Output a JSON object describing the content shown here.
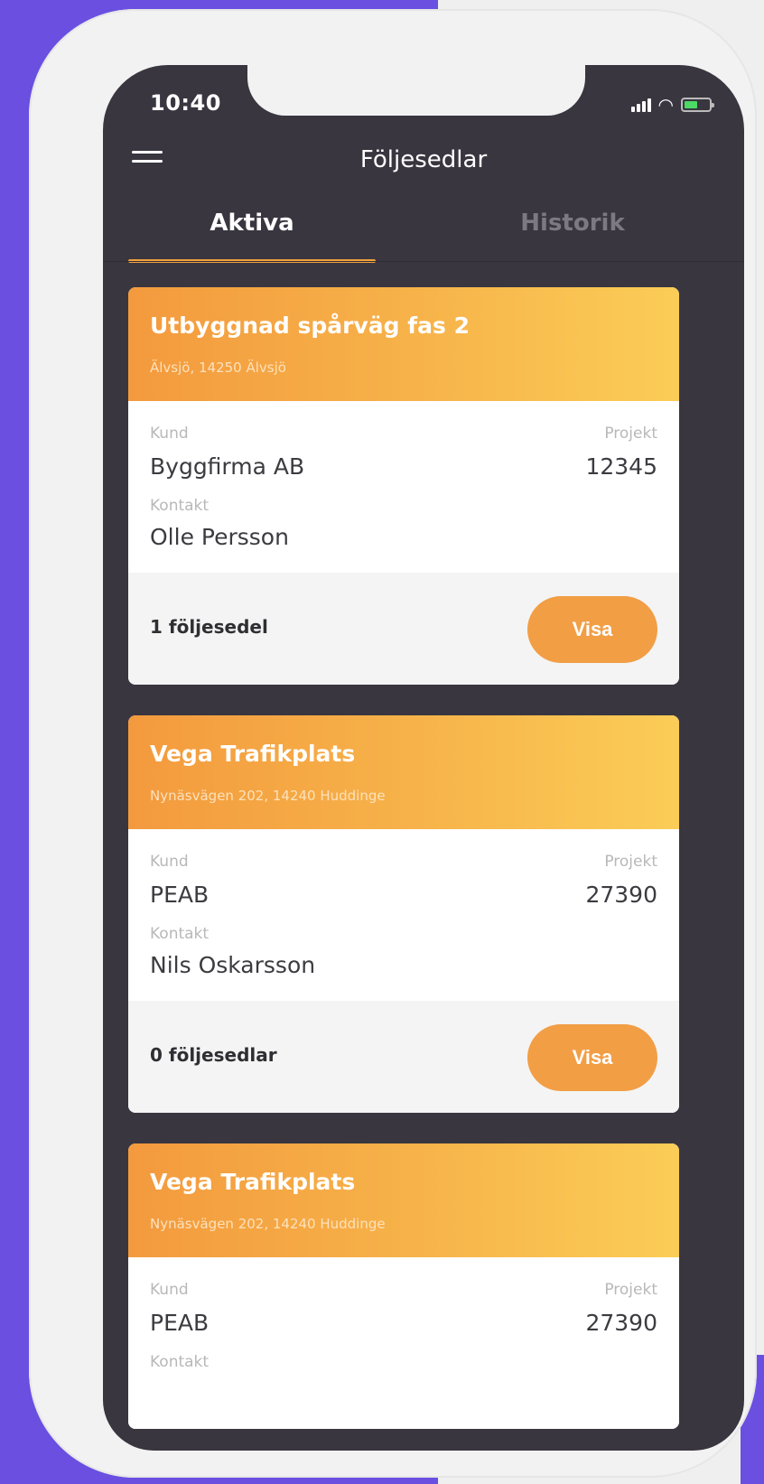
{
  "status": {
    "time": "10:40"
  },
  "header": {
    "title": "Följesedlar"
  },
  "tabs": [
    {
      "label": "Aktiva",
      "active": true
    },
    {
      "label": "Historik",
      "active": false
    }
  ],
  "labels": {
    "customer": "Kund",
    "project": "Projekt",
    "contact": "Kontakt",
    "view_button": "Visa"
  },
  "cards": [
    {
      "title": "Utbyggnad spårväg fas 2",
      "address": "Älvsjö, 14250 Älvsjö",
      "customer": "Byggfirma AB",
      "project": "12345",
      "contact": "Olle Persson",
      "count_text": "1 följesedel"
    },
    {
      "title": "Vega Trafikplats",
      "address": "Nynäsvägen 202, 14240 Huddinge",
      "customer": "PEAB",
      "project": "27390",
      "contact": "Nils Oskarsson",
      "count_text": "0 följesedlar"
    },
    {
      "title": "Vega Trafikplats",
      "address": "Nynäsvägen 202, 14240 Huddinge",
      "customer": "PEAB",
      "project": "27390"
    }
  ],
  "colors": {
    "background": "#6a4fe0",
    "screen": "#393640",
    "accent": "#f29e45",
    "header_gradient_start": "#f39a3e",
    "header_gradient_end": "#fbcd57"
  }
}
